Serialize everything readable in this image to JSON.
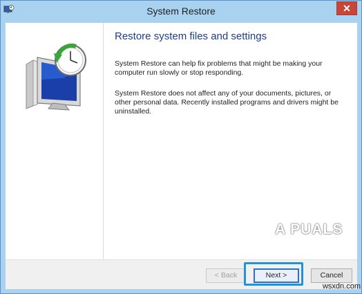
{
  "window": {
    "title": "System Restore",
    "close_symbol": "✕",
    "app_icon": "system-restore-icon"
  },
  "sidebar": {
    "illustration": "monitor-clock-restore-icon"
  },
  "main": {
    "heading": "Restore system files and settings",
    "paragraph_1": "System Restore can help fix problems that might be making your computer run slowly or stop responding.",
    "paragraph_2": "System Restore does not affect any of your documents, pictures, or other personal data. Recently installed programs and drivers might be uninstalled."
  },
  "footer": {
    "back_label": "< Back",
    "next_label": "Next >",
    "cancel_label": "Cancel"
  },
  "watermark": {
    "text": "A PUALS"
  },
  "credit": "wsxdn.com",
  "colors": {
    "title_bar": "#a9d2f0",
    "close_button": "#c7463a",
    "heading": "#1f3b8a",
    "highlight": "#1e95d8"
  }
}
